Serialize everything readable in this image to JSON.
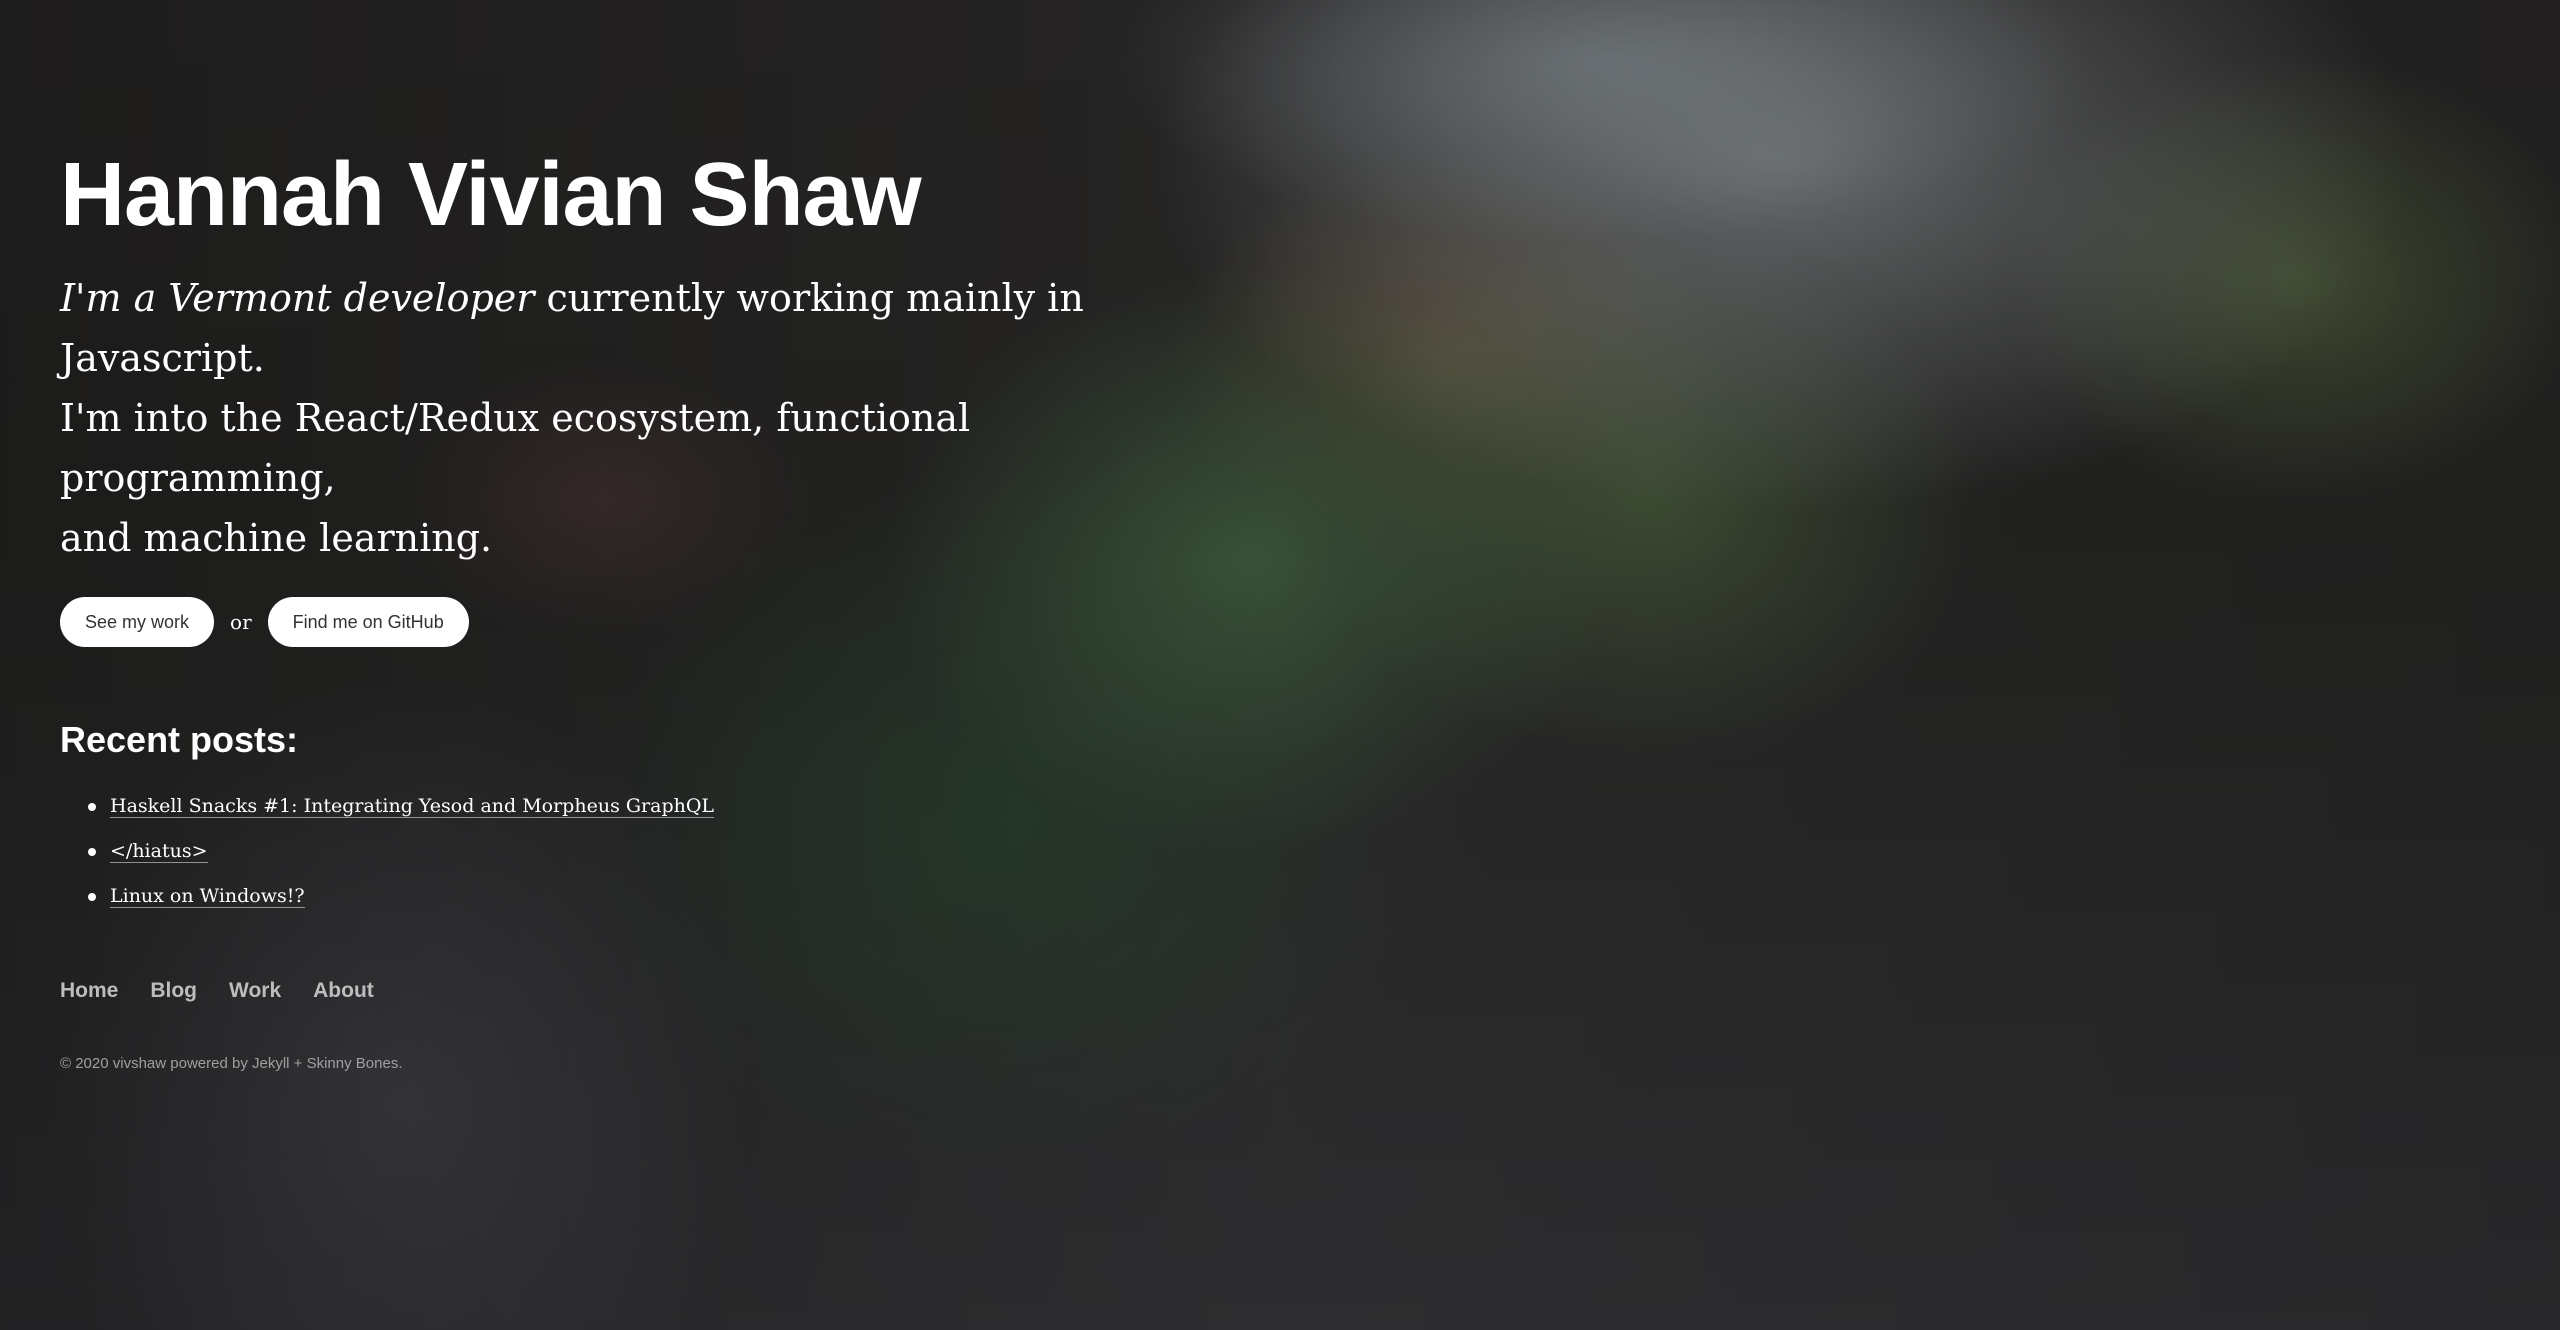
{
  "header": {
    "title": "Hannah Vivian Shaw"
  },
  "intro": {
    "emphasis": "I'm a Vermont developer",
    "line1_rest": " currently working mainly in Javascript.",
    "line2": "I'm into the React/Redux ecosystem, functional programming,",
    "line3": "and machine learning."
  },
  "actions": {
    "work_button": "See my work",
    "separator": "or",
    "github_button": "Find me on GitHub"
  },
  "recent_posts": {
    "heading": "Recent posts:",
    "items": [
      "Haskell Snacks #1: Integrating Yesod and Morpheus GraphQL",
      "</hiatus>",
      "Linux on Windows!?"
    ]
  },
  "nav": {
    "items": [
      "Home",
      "Blog",
      "Work",
      "About"
    ]
  },
  "footer": {
    "text": "© 2020 vivshaw powered by Jekyll + Skinny Bones."
  }
}
